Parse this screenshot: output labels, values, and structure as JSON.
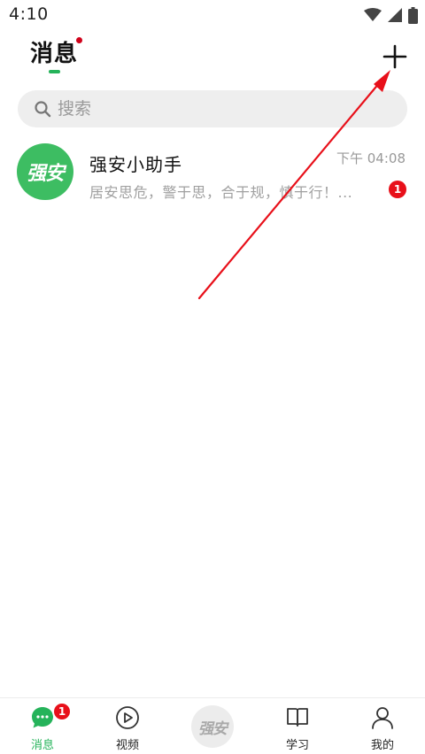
{
  "status_bar": {
    "time": "4:10",
    "icons": [
      "wifi-icon",
      "cellular-signal-icon",
      "battery-icon"
    ]
  },
  "header": {
    "title": "消息",
    "add_icon": "plus-icon"
  },
  "search": {
    "placeholder": "搜索"
  },
  "conversations": [
    {
      "avatar_text": "强安",
      "name": "强安小助手",
      "time": "下午 04:08",
      "preview": "居安思危，警于思，合于规，慎于行！...",
      "unread": "1"
    }
  ],
  "tab_bar": {
    "tabs": [
      {
        "label": "消息",
        "icon": "chat-bubble-icon",
        "badge": "1",
        "active": true
      },
      {
        "label": "视频",
        "icon": "play-circle-icon",
        "active": false
      },
      {
        "label": "学习",
        "icon": "book-icon",
        "active": false
      },
      {
        "label": "我的",
        "icon": "user-icon",
        "active": false
      }
    ],
    "center_logo_text": "强安"
  },
  "colors": {
    "accent": "#25b35a",
    "avatar_bg": "#3dbd62",
    "badge_red": "#e8101a",
    "arrow_red": "#e8101a"
  }
}
